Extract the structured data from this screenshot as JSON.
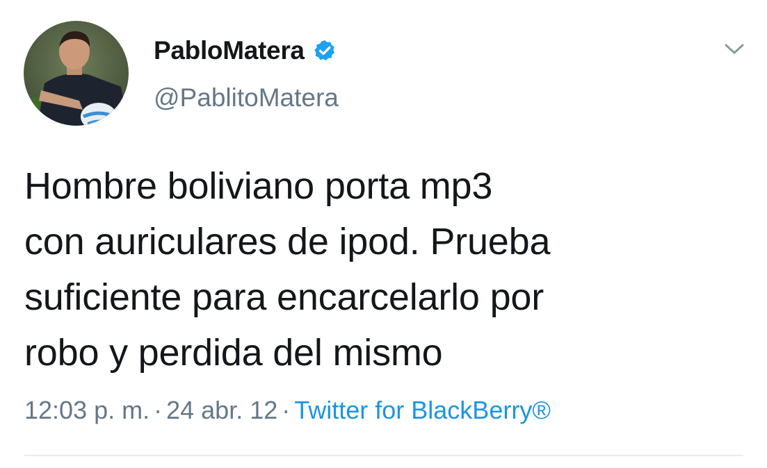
{
  "user": {
    "display_name": "PabloMatera",
    "handle": "@PablitoMatera",
    "verified": true
  },
  "tweet": {
    "text": "Hombre boliviano porta mp3\ncon auriculares de ipod. Prueba\nsuficiente para encarcelarlo por\nrobo y perdida del mismo"
  },
  "meta": {
    "time": "12:03 p. m.",
    "date": "24 abr. 12",
    "separator": "·",
    "source": "Twitter for BlackBerry®"
  },
  "colors": {
    "text": "#14171a",
    "secondary": "#657786",
    "link": "#1b95e0",
    "verified": "#1da1f2",
    "divider": "#e6ecf0"
  },
  "icons": {
    "verified": "verified-badge-icon",
    "more": "chevron-down-icon"
  }
}
